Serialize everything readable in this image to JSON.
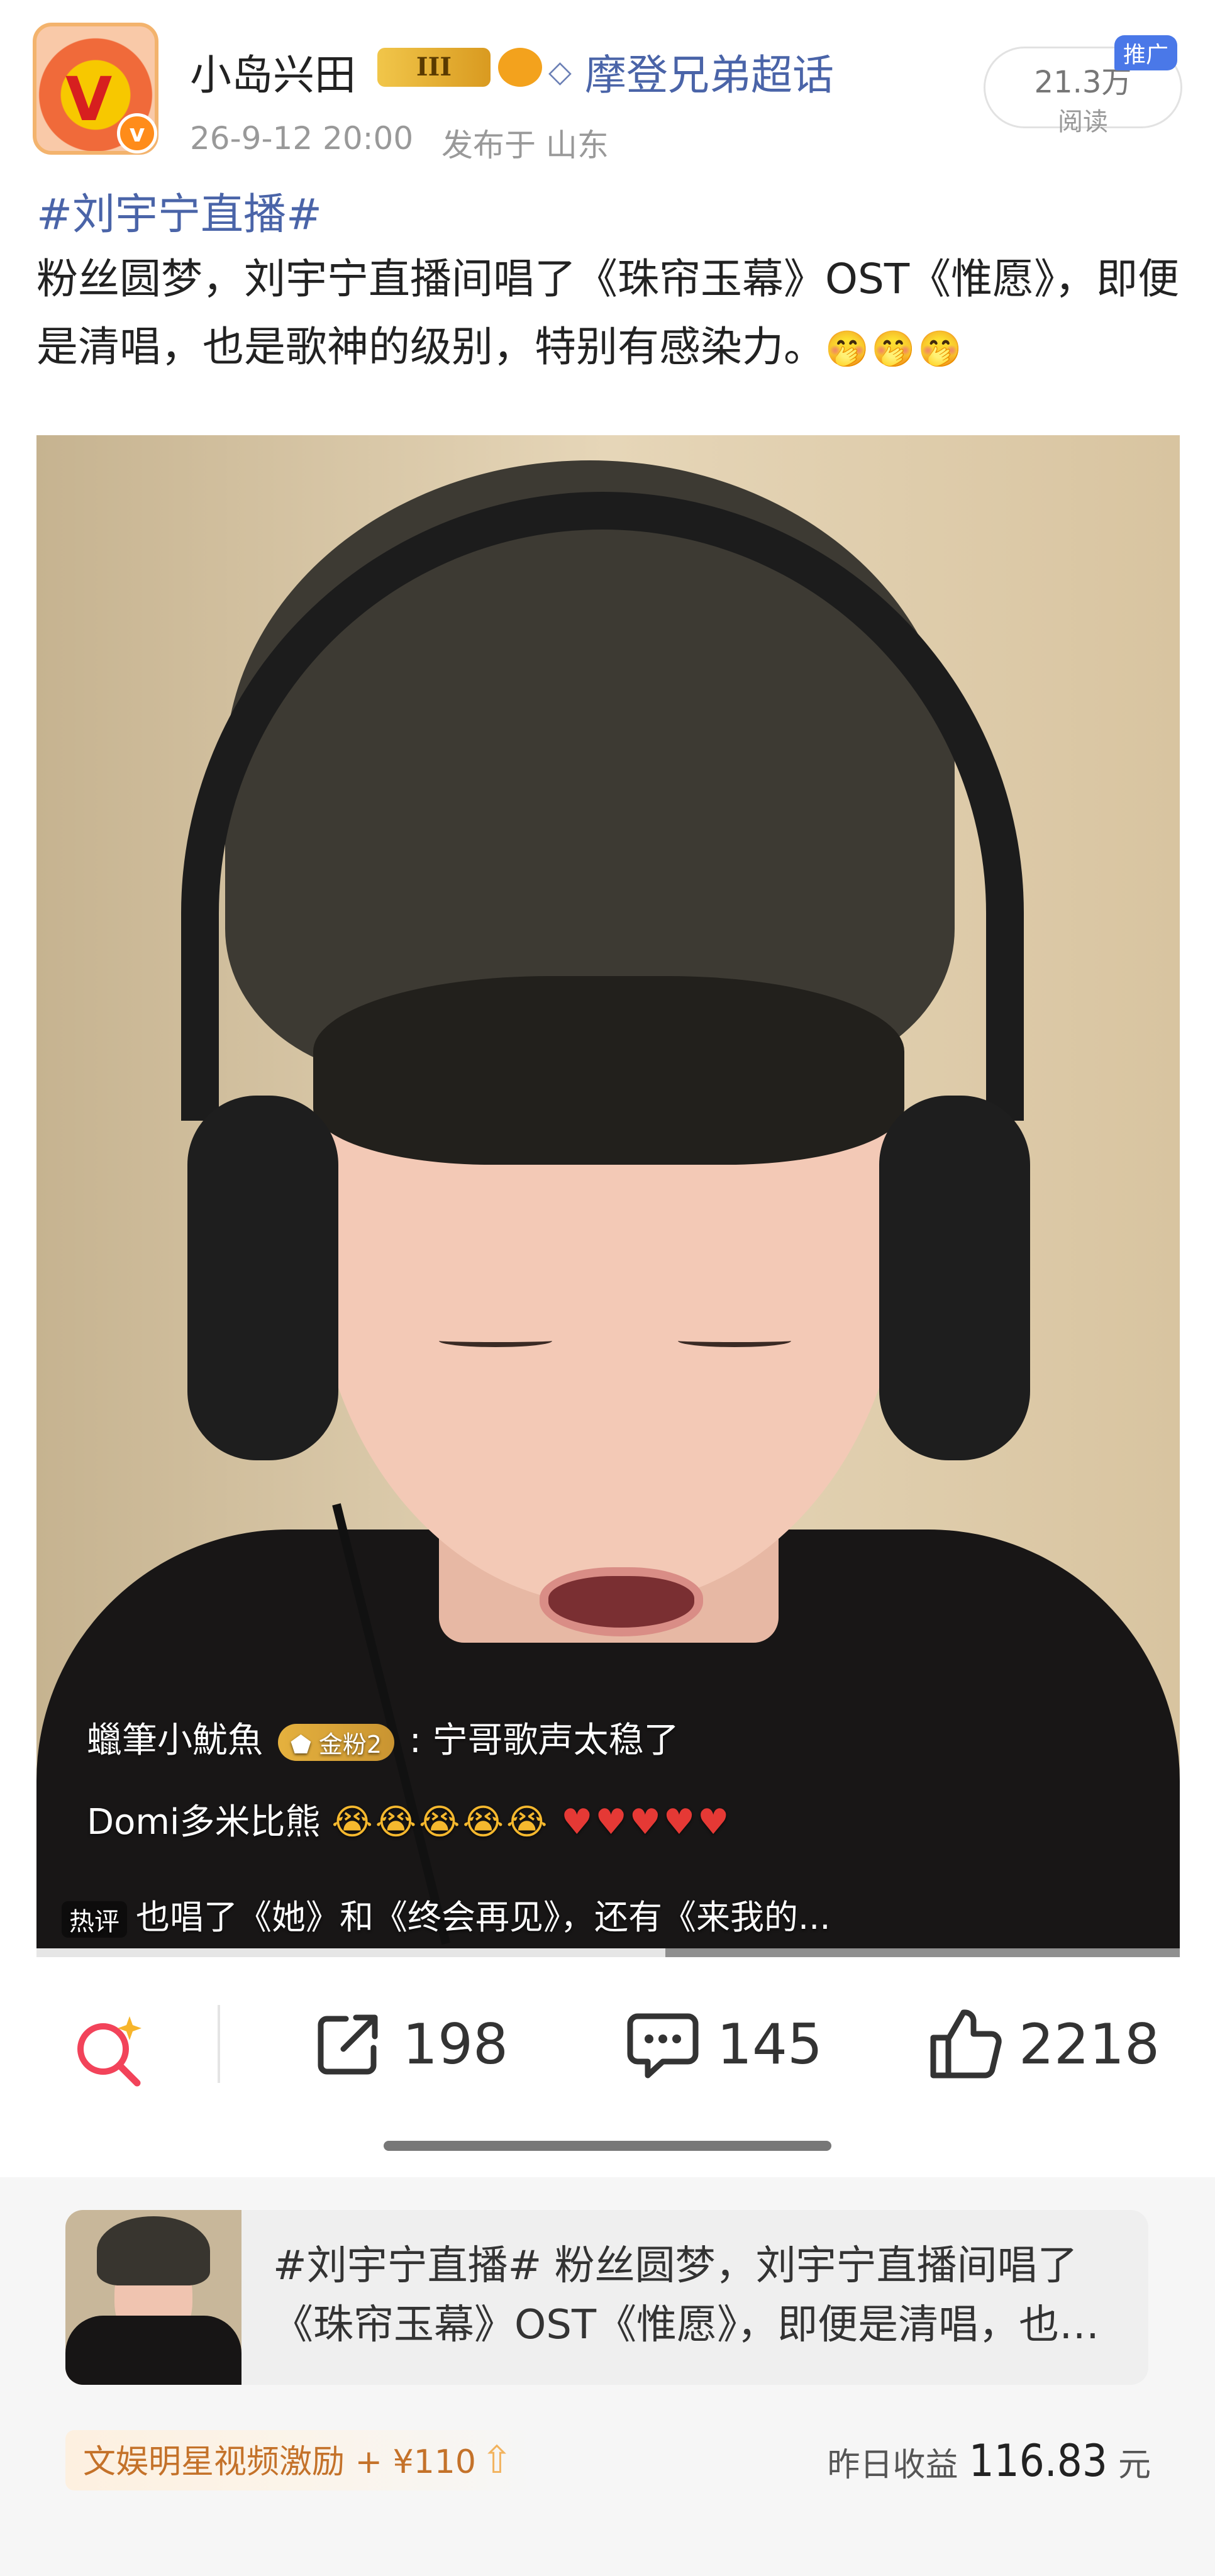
{
  "post": {
    "author": "小岛兴田",
    "level_badge": "III",
    "supertopic": "摩登兄弟超话",
    "time": "26-9-12 20:00",
    "location": "发布于 山东",
    "reads": "21.3万",
    "reads_label": "阅读",
    "promo_tag": "推广",
    "hashtag": "#刘宇宁直播#",
    "content": "粉丝圆梦，刘宇宁直播间唱了《珠帘玉幕》OST《惟愿》，即便是清唱，也是歌神的级别，特别有感染力。",
    "content_emojis": "🤭🤭🤭"
  },
  "video": {
    "comments": [
      {
        "user": "蠟筆小魷魚",
        "badge": "金粉2",
        "text": ": 宁哥歌声太稳了"
      },
      {
        "user": "Domi多米比熊",
        "faces": "😭😭😭😭😭",
        "hearts": "♥♥♥♥♥"
      }
    ],
    "hot_tag": "热评",
    "hot_text": "也唱了《她》和《终会再见》，还有《来我的...",
    "progress": 0.55
  },
  "actions": {
    "share": "198",
    "comments": "145",
    "likes": "2218"
  },
  "footer": {
    "card_text": "#刘宇宁直播# 粉丝圆梦，刘宇宁直播间唱了《珠帘玉幕》OST《惟愿》，即便是清唱，也是歌神的级别，特别有感染力。",
    "incentive": "文娱明星视频激励 + ¥110",
    "yesterday_label": "昨日收益",
    "yesterday_amount": "116.83",
    "yesterday_unit": "元"
  },
  "colors": {
    "link": "#4a64a8",
    "promo": "#4a78e8",
    "incentive": "#c4722a"
  }
}
